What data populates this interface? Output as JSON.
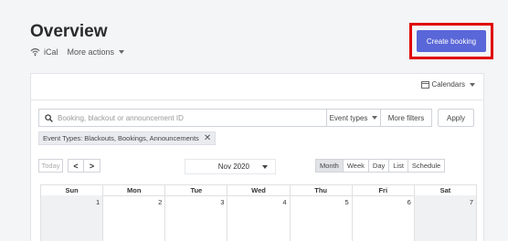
{
  "header": {
    "title": "Overview",
    "ical_label": "iCal",
    "more_actions_label": "More actions"
  },
  "create_booking_label": "Create booking",
  "panel": {
    "calendars_label": "Calendars"
  },
  "search": {
    "placeholder": "Booking, blackout or announcement ID",
    "event_types_label": "Event types",
    "more_filters_label": "More filters",
    "apply_label": "Apply"
  },
  "filter_chip": {
    "label": "Event Types: Blackouts, Bookings, Announcements",
    "close_glyph": "✕"
  },
  "toolbar": {
    "today_label": "Today",
    "prev_glyph": "<",
    "next_glyph": ">",
    "month_value": "Nov 2020",
    "views": [
      {
        "label": "Month",
        "active": true
      },
      {
        "label": "Week",
        "active": false
      },
      {
        "label": "Day",
        "active": false
      },
      {
        "label": "List",
        "active": false
      },
      {
        "label": "Schedule",
        "active": false
      }
    ]
  },
  "calendar": {
    "weekdays": [
      "Sun",
      "Mon",
      "Tue",
      "Wed",
      "Thu",
      "Fri",
      "Sat"
    ],
    "first_week": [
      {
        "day": "1",
        "shaded": true
      },
      {
        "day": "2",
        "shaded": false
      },
      {
        "day": "3",
        "shaded": false
      },
      {
        "day": "4",
        "shaded": false
      },
      {
        "day": "5",
        "shaded": false
      },
      {
        "day": "6",
        "shaded": false
      },
      {
        "day": "7",
        "shaded": true
      }
    ]
  },
  "colors": {
    "primary": "#5a67d8",
    "highlight": "#e00000",
    "background": "#f4f5f7"
  },
  "icons": {
    "wifi": "wifi-icon",
    "calendar": "calendar-icon",
    "search": "search-icon"
  }
}
